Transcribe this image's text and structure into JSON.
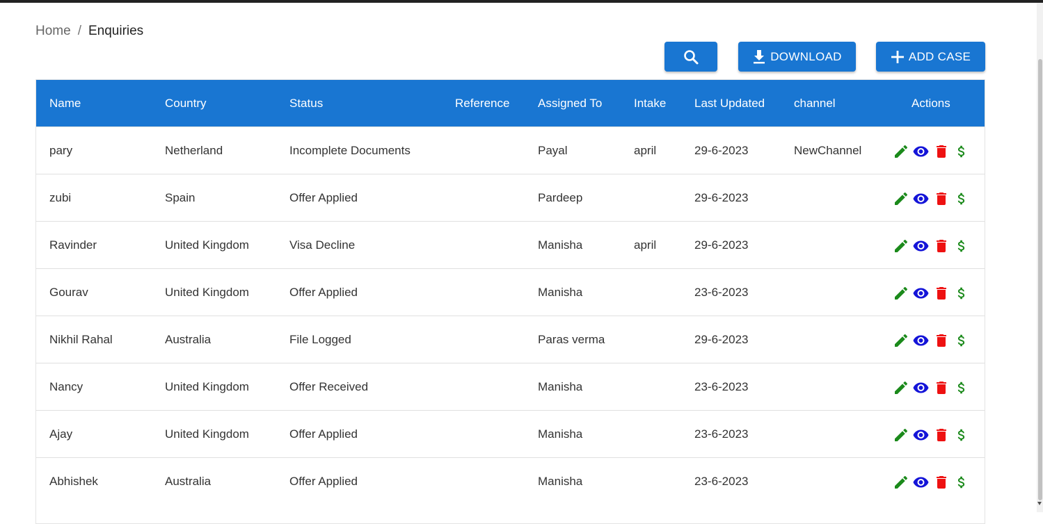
{
  "breadcrumb": {
    "home": "Home",
    "separator": "/",
    "current": "Enquiries"
  },
  "toolbar": {
    "search_icon": "search-icon",
    "download_label": "DOWNLOAD",
    "add_label": "ADD CASE"
  },
  "colors": {
    "primary": "#1976d2",
    "edit": "#1b8a1b",
    "view": "#1414d8",
    "delete": "#ee1111",
    "payment": "#1b8a1b"
  },
  "table": {
    "headers": [
      "Name",
      "Country",
      "Status",
      "Reference",
      "Assigned To",
      "Intake",
      "Last Updated",
      "channel",
      "Actions"
    ],
    "rows": [
      {
        "name": "pary",
        "country": "Netherland",
        "status": "Incomplete Documents",
        "reference": "",
        "assigned": "Payal",
        "intake": "april",
        "updated": "29-6-2023",
        "channel": "NewChannel"
      },
      {
        "name": "zubi",
        "country": "Spain",
        "status": "Offer Applied",
        "reference": "",
        "assigned": "Pardeep",
        "intake": "",
        "updated": "29-6-2023",
        "channel": ""
      },
      {
        "name": "Ravinder",
        "country": "United Kingdom",
        "status": "Visa Decline",
        "reference": "",
        "assigned": "Manisha",
        "intake": "april",
        "updated": "29-6-2023",
        "channel": ""
      },
      {
        "name": "Gourav",
        "country": "United Kingdom",
        "status": "Offer Applied",
        "reference": "",
        "assigned": "Manisha",
        "intake": "",
        "updated": "23-6-2023",
        "channel": ""
      },
      {
        "name": "Nikhil Rahal",
        "country": "Australia",
        "status": "File Logged",
        "reference": "",
        "assigned": "Paras verma",
        "intake": "",
        "updated": "29-6-2023",
        "channel": ""
      },
      {
        "name": "Nancy",
        "country": "United Kingdom",
        "status": "Offer Received",
        "reference": "",
        "assigned": "Manisha",
        "intake": "",
        "updated": "23-6-2023",
        "channel": ""
      },
      {
        "name": "Ajay",
        "country": "United Kingdom",
        "status": "Offer Applied",
        "reference": "",
        "assigned": "Manisha",
        "intake": "",
        "updated": "23-6-2023",
        "channel": ""
      },
      {
        "name": "Abhishek",
        "country": "Australia",
        "status": "Offer Applied",
        "reference": "",
        "assigned": "Manisha",
        "intake": "",
        "updated": "23-6-2023",
        "channel": ""
      }
    ],
    "row_actions": [
      "edit-icon",
      "view-icon",
      "delete-icon",
      "payment-icon"
    ]
  }
}
